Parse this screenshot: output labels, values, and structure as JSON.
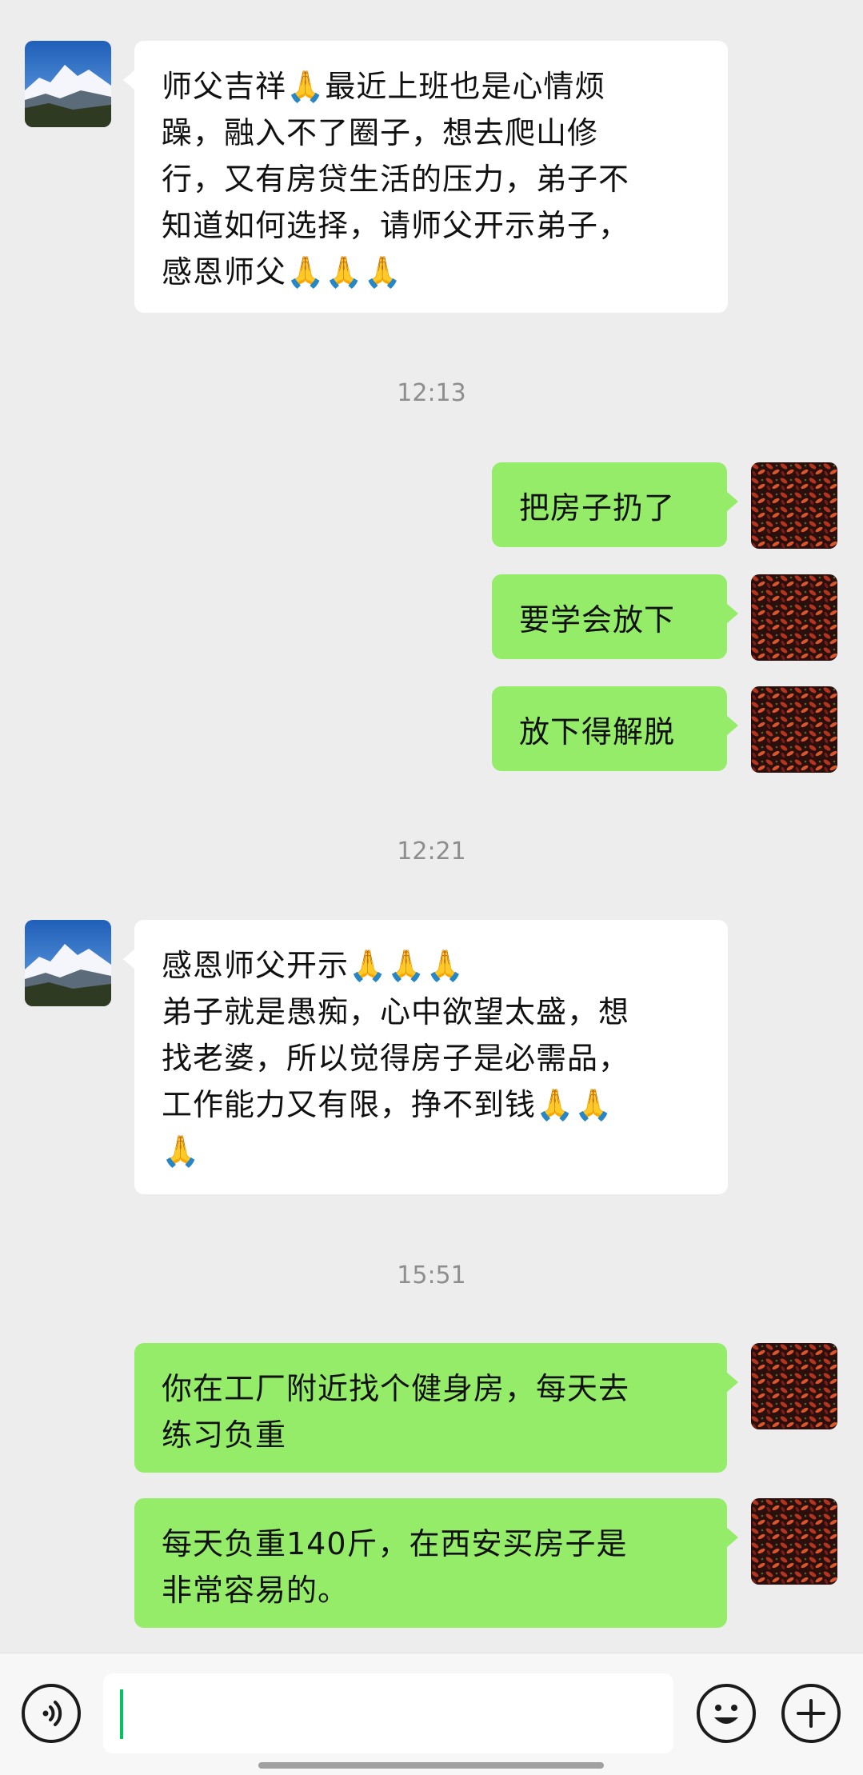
{
  "messages": [
    {
      "direction": "incoming",
      "avatar": "mountain-avatar",
      "lines": [
        "师父吉祥🙏最近上班也是心情烦",
        "躁，融入不了圈子，想去爬山修",
        "行，又有房贷生活的压力，弟子不",
        "知道如何选择，请师父开示弟子，",
        "感恩师父🙏🙏🙏"
      ]
    },
    {
      "type": "time",
      "text": "12:13"
    },
    {
      "direction": "outgoing",
      "avatar": "red-leaves-avatar",
      "lines": [
        "把房子扔了"
      ]
    },
    {
      "direction": "outgoing",
      "avatar": "red-leaves-avatar",
      "lines": [
        "要学会放下"
      ]
    },
    {
      "direction": "outgoing",
      "avatar": "red-leaves-avatar",
      "lines": [
        "放下得解脱"
      ]
    },
    {
      "type": "time",
      "text": "12:21"
    },
    {
      "direction": "incoming",
      "avatar": "mountain-avatar",
      "lines": [
        "感恩师父开示🙏🙏🙏",
        "弟子就是愚痴，心中欲望太盛，想",
        "找老婆，所以觉得房子是必需品，",
        "工作能力又有限，挣不到钱🙏🙏",
        "🙏"
      ]
    },
    {
      "type": "time",
      "text": "15:51"
    },
    {
      "direction": "outgoing",
      "avatar": "red-leaves-avatar",
      "lines": [
        "你在工厂附近找个健身房，每天去",
        "练习负重"
      ]
    },
    {
      "direction": "outgoing",
      "avatar": "red-leaves-avatar",
      "lines": [
        "每天负重140斤，在西安买房子是",
        "非常容易的。"
      ]
    }
  ],
  "input_bar": {
    "voice_icon": "voice-icon",
    "input_value": "",
    "emoji_icon": "emoji-icon",
    "plus_icon": "plus-icon"
  },
  "colors": {
    "background": "#ededed",
    "incoming_bubble": "#ffffff",
    "outgoing_bubble": "#95ec69",
    "timestamp": "#8e8e8e",
    "caret": "#07c160"
  }
}
